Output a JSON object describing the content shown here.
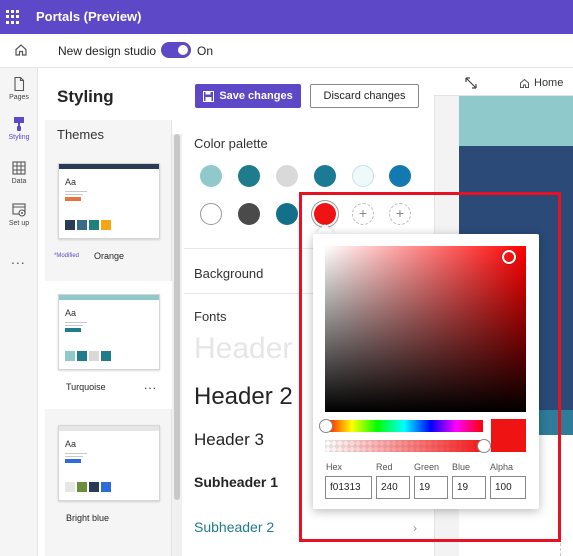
{
  "app": {
    "title": "Portals (Preview)"
  },
  "subbar": {
    "new_design_studio_label": "New design studio",
    "toggle_state": "On"
  },
  "rail": {
    "items": [
      {
        "label": "Pages",
        "icon": "page-icon"
      },
      {
        "label": "Styling",
        "icon": "paintbrush-icon"
      },
      {
        "label": "Data",
        "icon": "table-icon"
      },
      {
        "label": "Set up",
        "icon": "settings-icon"
      }
    ],
    "more": "..."
  },
  "styling": {
    "title": "Styling",
    "save_label": "Save changes",
    "discard_label": "Discard changes"
  },
  "themes": {
    "header": "Themes",
    "modified_badge": "*Modified",
    "items": [
      {
        "name": "Orange",
        "bar_color": "#2b3a55",
        "button_color": "#e8743b",
        "swatches": [
          "#2b3a55",
          "#3a6a8a",
          "#20807a",
          "#f3a712"
        ]
      },
      {
        "name": "Turquoise",
        "bar_color": "#8fc9cb",
        "button_color": "#1f7c8a",
        "swatches": [
          "#8fc9cb",
          "#1f7c8a",
          "#d9d9d9",
          "#1f7c8a"
        ]
      },
      {
        "name": "Bright blue",
        "bar_color": "#e6e6e6",
        "button_color": "#2d6bd9",
        "swatches": [
          "#e6e6e6",
          "#6b8e3a",
          "#2b3a55",
          "#2d6bd9"
        ]
      }
    ],
    "more_options": "..."
  },
  "palette": {
    "title": "Color palette",
    "colors": [
      "#8fc9cb",
      "#1f7c8a",
      "#d9d9d9",
      "#1b7a94",
      "#eefafa",
      "#1379b0",
      "#ffffff",
      "#4a4a4a",
      "#13708a",
      "#f01313"
    ],
    "add_symbol": "+"
  },
  "background": {
    "title": "Background"
  },
  "fonts": {
    "title": "Fonts",
    "header1": "Header",
    "header2": "Header 2",
    "header3": "Header 3",
    "subheader1": "Subheader 1",
    "subheader2": "Subheader 2",
    "chevron": "›"
  },
  "canvas": {
    "breadcrumb_home": "Home"
  },
  "color_picker": {
    "hex_label": "Hex",
    "red_label": "Red",
    "green_label": "Green",
    "blue_label": "Blue",
    "alpha_label": "Alpha",
    "hex_value": "f01313",
    "red_value": "240",
    "green_value": "19",
    "blue_value": "19",
    "alpha_value": "100",
    "selected_color": "#f01313"
  },
  "colors": {
    "brand": "#5d48c8",
    "highlight": "#e81123"
  }
}
